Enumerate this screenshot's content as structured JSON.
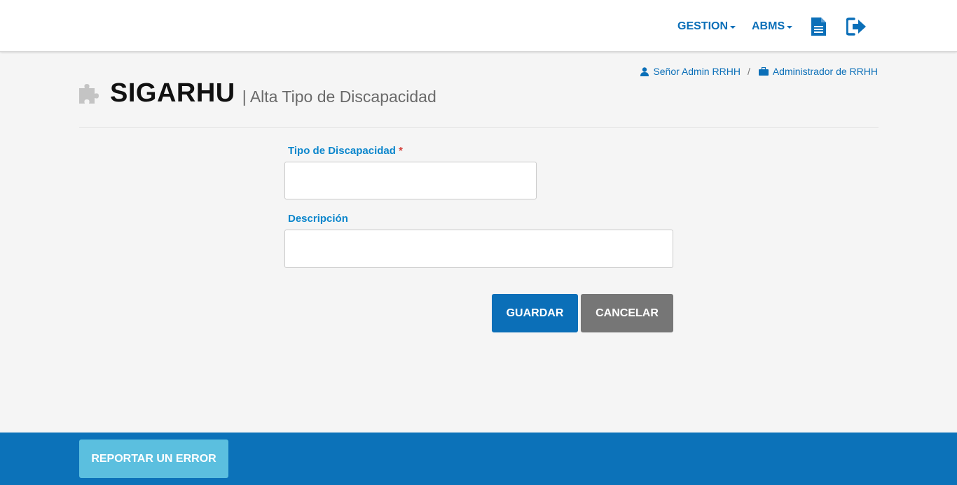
{
  "nav": {
    "menus": [
      {
        "label": "GESTION"
      },
      {
        "label": "ABMS"
      }
    ],
    "icons": [
      "document-icon",
      "logout-icon"
    ]
  },
  "userbar": {
    "user": "Señor Admin RRHH",
    "separator": "/",
    "role": "Administrador de RRHH"
  },
  "header": {
    "title": "SIGARHU",
    "subtitle": "| Alta Tipo de Discapacidad"
  },
  "form": {
    "tipo": {
      "label": "Tipo de Discapacidad",
      "required_mark": "*",
      "value": ""
    },
    "descripcion": {
      "label": "Descripción",
      "value": ""
    },
    "save_label": "GUARDAR",
    "cancel_label": "CANCELAR"
  },
  "footer": {
    "report_label": "REPORTAR UN ERROR"
  },
  "colors": {
    "primary": "#0b6fb8",
    "label": "#0b86cc",
    "cancel": "#767676",
    "footer": "#0c72b9",
    "report": "#5bbfdf",
    "required": "#d43f3a"
  }
}
